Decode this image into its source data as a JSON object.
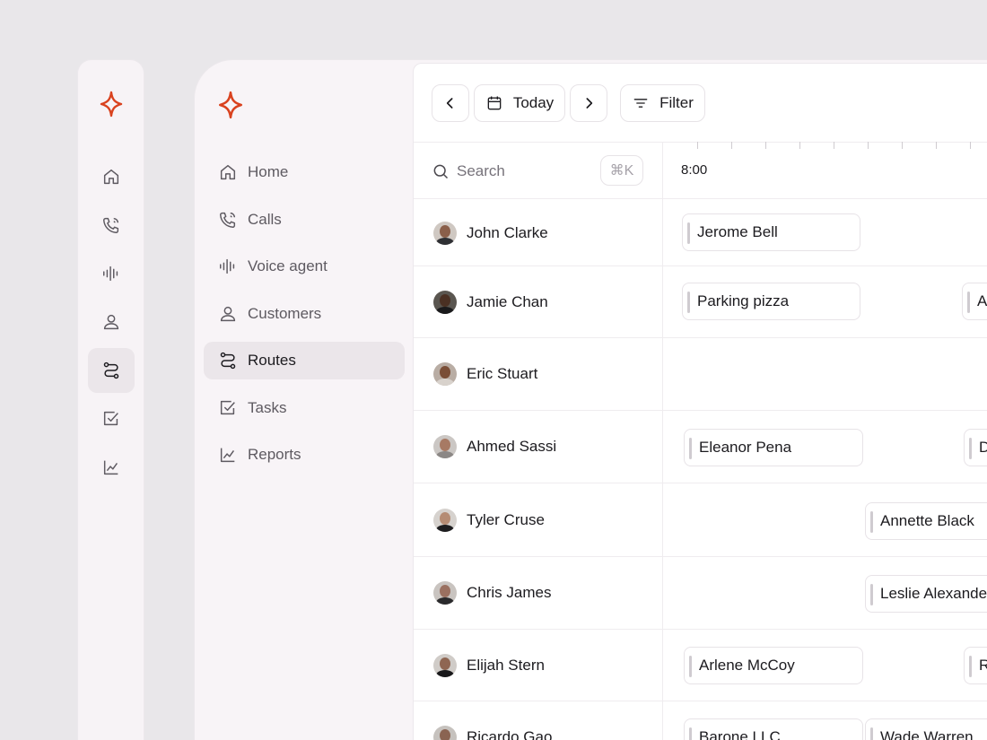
{
  "colors": {
    "brand": "#d9421f",
    "page_bg": "#e9e7ea",
    "panel_bg": "#f8f4f7",
    "active_bg": "#ebe6ea"
  },
  "rail": {
    "logo_icon": "sparkle-icon",
    "items": [
      {
        "icon": "home-icon"
      },
      {
        "icon": "phone-icon"
      },
      {
        "icon": "waveform-icon"
      },
      {
        "icon": "user-icon"
      },
      {
        "icon": "route-icon",
        "active": true
      },
      {
        "icon": "checkbox-icon"
      },
      {
        "icon": "chart-line-icon"
      }
    ]
  },
  "nav": {
    "items": [
      {
        "label": "Home",
        "icon": "home-icon"
      },
      {
        "label": "Calls",
        "icon": "phone-icon"
      },
      {
        "label": "Voice agent",
        "icon": "waveform-icon"
      },
      {
        "label": "Customers",
        "icon": "user-icon"
      },
      {
        "label": "Routes",
        "icon": "route-icon",
        "active": true
      },
      {
        "label": "Tasks",
        "icon": "checkbox-icon"
      },
      {
        "label": "Reports",
        "icon": "chart-line-icon"
      }
    ]
  },
  "toolbar": {
    "prev_icon": "chevron-left-icon",
    "today_label": "Today",
    "next_icon": "chevron-right-icon",
    "filter_label": "Filter"
  },
  "search": {
    "placeholder": "Search",
    "shortcut": "⌘K"
  },
  "timeline": {
    "time_label": "8:00"
  },
  "rows": [
    {
      "name": "John Clarke",
      "events": [
        "Jerome Bell"
      ]
    },
    {
      "name": "Jamie Chan",
      "events": [
        "Parking pizza",
        "A"
      ]
    },
    {
      "name": "Eric Stuart",
      "events": []
    },
    {
      "name": "Ahmed Sassi",
      "events": [
        "Eleanor Pena",
        "D"
      ]
    },
    {
      "name": "Tyler Cruse",
      "events": [
        "Annette Black"
      ]
    },
    {
      "name": "Chris James",
      "events": [
        "Leslie Alexander"
      ]
    },
    {
      "name": "Elijah Stern",
      "events": [
        "Arlene McCoy",
        "R"
      ]
    },
    {
      "name": "Ricardo Gao",
      "events": [
        "Barone LLC",
        "Wade Warren"
      ]
    }
  ]
}
